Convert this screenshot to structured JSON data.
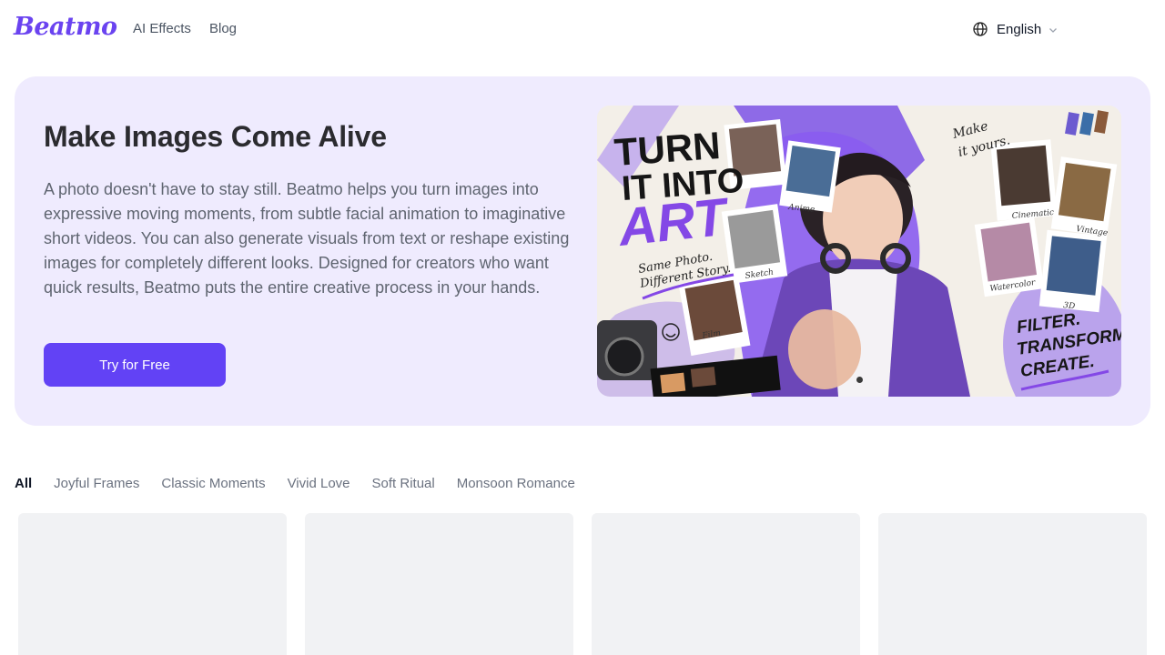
{
  "header": {
    "logo": "Beatmo",
    "nav": [
      {
        "label": "AI Effects"
      },
      {
        "label": "Blog"
      }
    ],
    "language": {
      "label": "English",
      "icon": "globe-icon"
    }
  },
  "hero": {
    "title": "Make Images Come Alive",
    "description": "A photo doesn't have to stay still. Beatmo helps you turn images into expressive moving moments, from subtle facial animation to imaginative short videos. You can also generate visuals from text or reshape existing images for completely different looks. Designed for creators who want quick results, Beatmo puts the entire creative process in your hands.",
    "cta_label": "Try for Free",
    "banner": {
      "headline_1": "TURN",
      "headline_2": "IT INTO",
      "headline_3": "ART",
      "tagline_1": "Same Photo.",
      "tagline_2": "Different Story.",
      "make_1": "Make",
      "make_2": "it yours.",
      "footer_1": "FILTER.",
      "footer_2": "TRANSFORM.",
      "footer_3": "CREATE.",
      "styles": [
        "Anime",
        "Sketch",
        "Film",
        "Cinematic",
        "Vintage",
        "Watercolor",
        "3D"
      ]
    }
  },
  "filters": {
    "tabs": [
      "All",
      "Joyful Frames",
      "Classic Moments",
      "Vivid Love",
      "Soft Ritual",
      "Monsoon Romance"
    ],
    "active": "All"
  },
  "colors": {
    "brand": "#6a43f0",
    "cta": "#6242f5",
    "hero_bg": "#efebfe",
    "card_bg": "#f1f2f4"
  }
}
